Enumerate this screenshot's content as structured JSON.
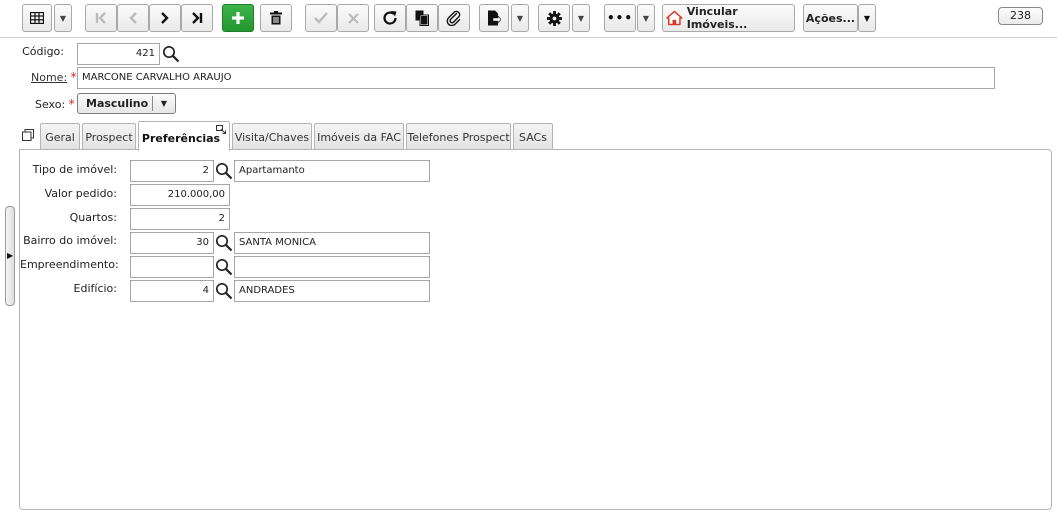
{
  "toolbar": {
    "vincular_label": "Vincular Imóveis...",
    "acoes_label": "Ações...",
    "record_count": "238"
  },
  "form": {
    "codigo_label": "Código:",
    "codigo_value": "421",
    "nome_label": "Nome:",
    "nome_value": "MARCONE CARVALHO ARAUJO",
    "sexo_label": "Sexo:",
    "sexo_value": "Masculino"
  },
  "tabs": [
    {
      "label": "Geral"
    },
    {
      "label": "Prospect"
    },
    {
      "label": "Preferências"
    },
    {
      "label": "Visita/Chaves"
    },
    {
      "label": "Imóveis da FAC"
    },
    {
      "label": "Telefones Prospect"
    },
    {
      "label": "SACs"
    }
  ],
  "preferencias": {
    "tipo_label": "Tipo de imóvel:",
    "tipo_code": "2",
    "tipo_desc": "Apartamanto",
    "valor_label": "Valor pedido:",
    "valor_value": "210.000,00",
    "quartos_label": "Quartos:",
    "quartos_value": "2",
    "bairro_label": "Bairro do imóvel:",
    "bairro_code": "30",
    "bairro_desc": "SANTA MONICA",
    "empreend_label": "Empreendimento:",
    "empreend_code": "",
    "empreend_desc": "",
    "edificio_label": "Edifício:",
    "edificio_code": "4",
    "edificio_desc": "ANDRADES"
  },
  "colors": {
    "accent_green": "#2aa238",
    "required_red": "#dd2222",
    "home_icon_red": "#d9392b"
  }
}
